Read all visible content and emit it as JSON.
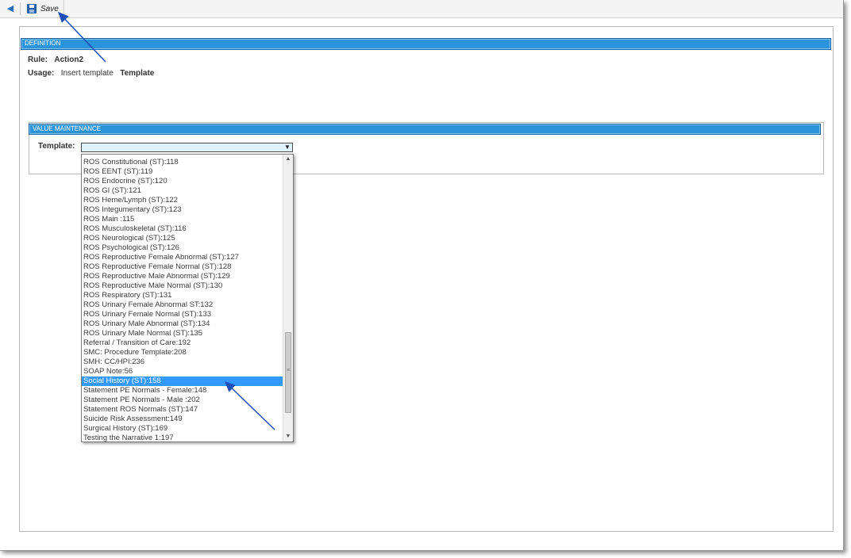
{
  "toolbar": {
    "save_label": "Save"
  },
  "section1": {
    "title": "DEFINITION"
  },
  "rule": {
    "label": "Rule:",
    "value": "Action2"
  },
  "usage": {
    "label": "Usage:",
    "value": "Insert template",
    "value2": "Template"
  },
  "section2": {
    "title": "VALUE MAINTENANCE"
  },
  "template": {
    "label": "Template:",
    "selected_value": "",
    "options": [
      "ROS Constitutional (ST):118",
      "ROS EENT (ST):119",
      "ROS Endocrine (ST):120",
      "ROS GI (ST):121",
      "ROS Heme/Lymph (ST):122",
      "ROS Integumentary (ST):123",
      "ROS Main :115",
      "ROS Musculoskeletal (ST):116",
      "ROS Neurological (ST):125",
      "ROS Psychological (ST):126",
      "ROS Reproductive Female Abnormal (ST):127",
      "ROS Reproductive Female Normal (ST):128",
      "ROS Reproductive Male Abnormal (ST):129",
      "ROS Reproductive Male Normal (ST):130",
      "ROS Respiratory (ST):131",
      "ROS Urinary Female Abnormal ST:132",
      "ROS Urinary Female Normal (ST):133",
      "ROS Urinary Male Abnormal (ST):134",
      "ROS Urinary Male Normal (ST):135",
      "Referral / Transition of Care:192",
      "SMC: Procedure Template:208",
      "SMH: CC/HPI:236",
      "SOAP Note:56",
      "Social History (ST):158",
      "Statement PE Normals - Female:148",
      "Statement PE Normals - Male :202",
      "Statement ROS Normals (ST):147",
      "Suicide Risk Assessment:149",
      "Surgical History (ST):169",
      "Testing the Narrative 1:197"
    ],
    "highlighted_index": 23
  },
  "colors": {
    "section_bar": "#2b93da",
    "selection": "#3399ff",
    "annotation_arrow": "#1f4fb8"
  },
  "icons": {
    "back": "back-arrow-icon",
    "save": "floppy-disk-icon",
    "dropdown": "chevron-down-icon"
  }
}
